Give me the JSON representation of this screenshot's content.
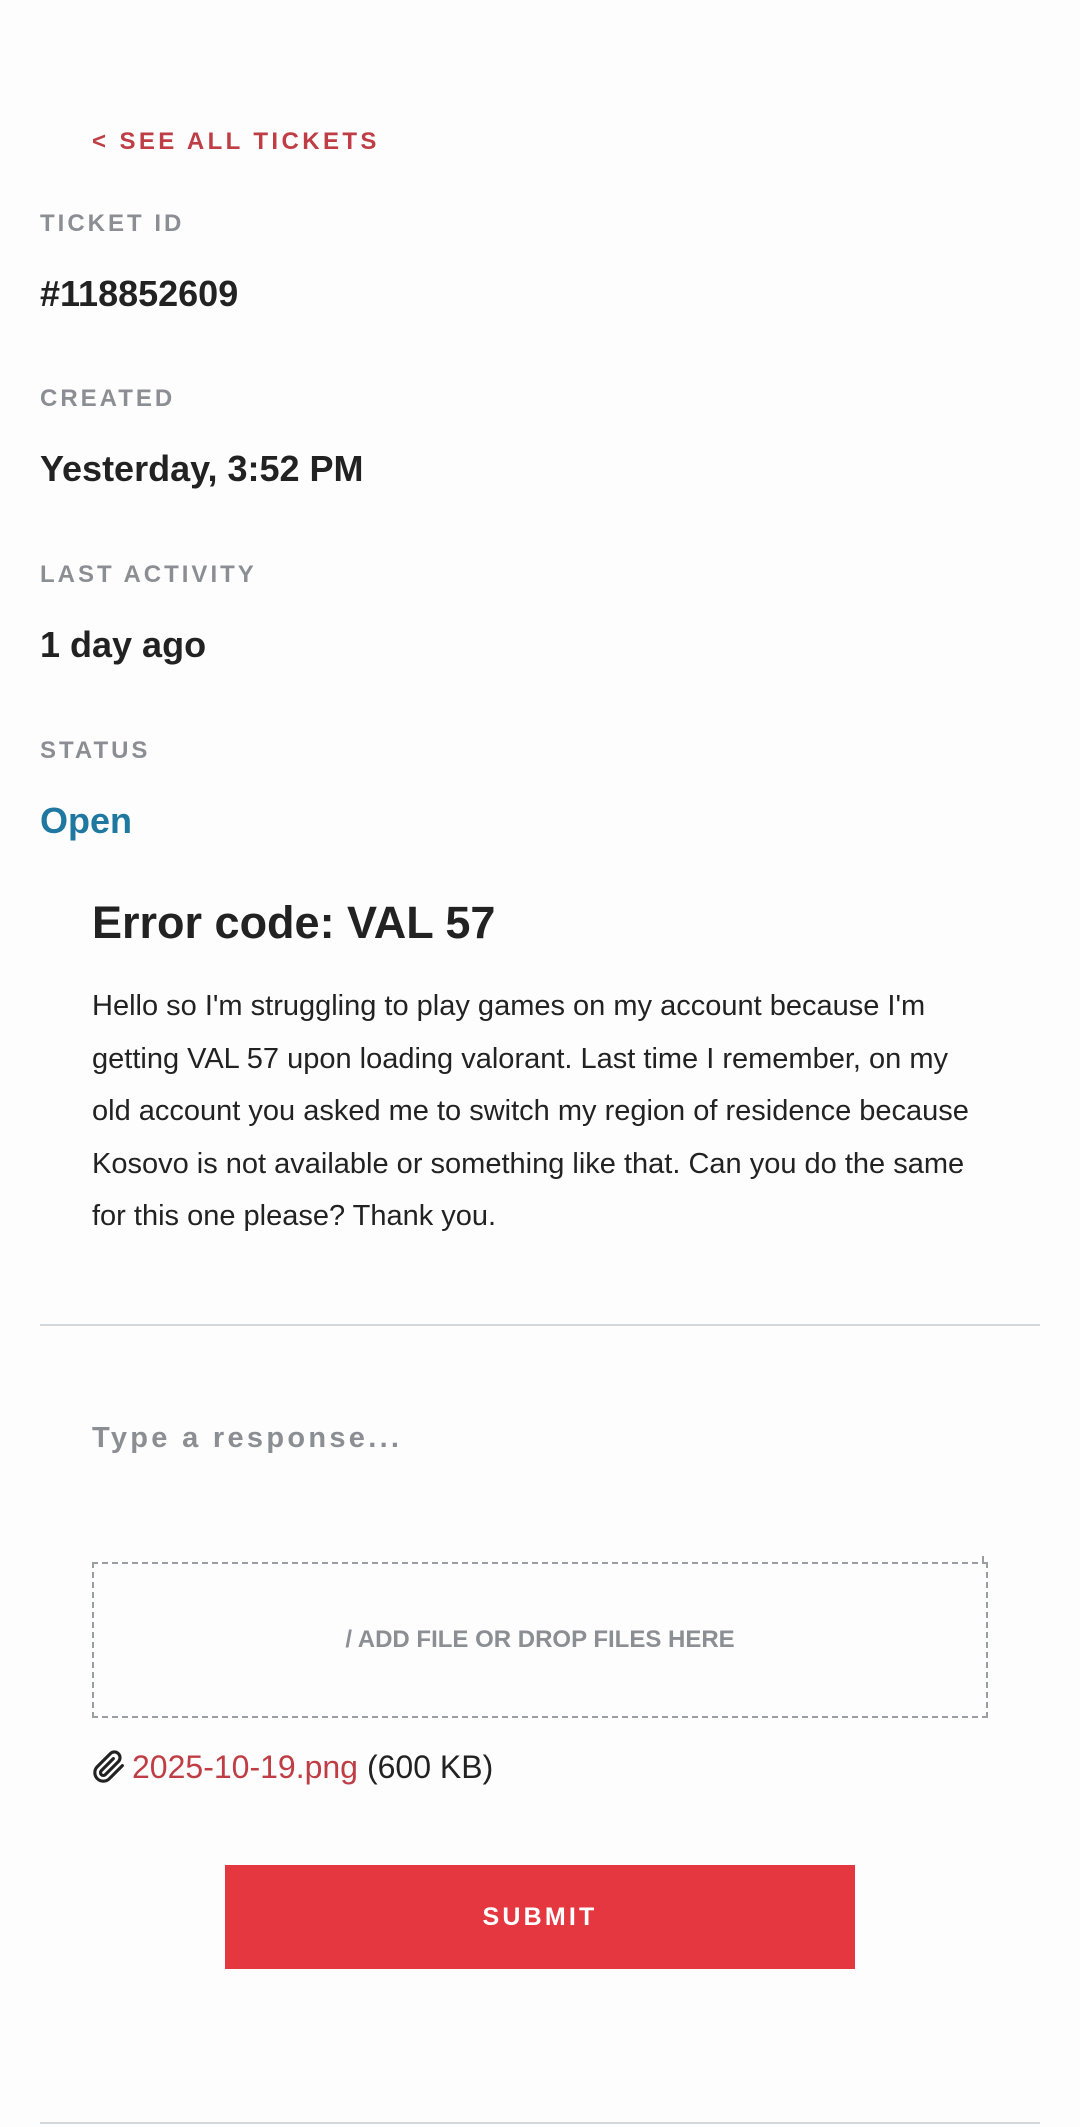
{
  "back_link": {
    "label": "< SEE ALL TICKETS"
  },
  "ticket": {
    "id_label": "TICKET ID",
    "id_value": "#118852609",
    "created_label": "CREATED",
    "created_value": "Yesterday, 3:52 PM",
    "activity_label": "LAST ACTIVITY",
    "activity_value": "1 day ago",
    "status_label": "STATUS",
    "status_value": "Open",
    "status_color": "#1f78a0"
  },
  "message": {
    "title": "Error code: VAL 57",
    "body": "Hello so I'm struggling to play games on my account because I'm getting VAL 57 upon loading valorant. Last time I remember, on my old account you asked me to switch my region of residence because Kosovo is not available or something like that. Can you do the same for this one please? Thank you."
  },
  "reply": {
    "input_value": "",
    "input_placeholder": "Type a response...",
    "dropzone_label": "/ ADD FILE OR DROP FILES HERE",
    "attachment": {
      "icon": "paperclip-icon",
      "file_name": "2025-10-19.png",
      "file_size": "(600 KB)"
    },
    "submit_label": "SUBMIT"
  },
  "colors": {
    "accent": "#bf3d44",
    "submit": "#e4373f",
    "label_gray": "#8b8f94",
    "status_open": "#1f78a0"
  }
}
